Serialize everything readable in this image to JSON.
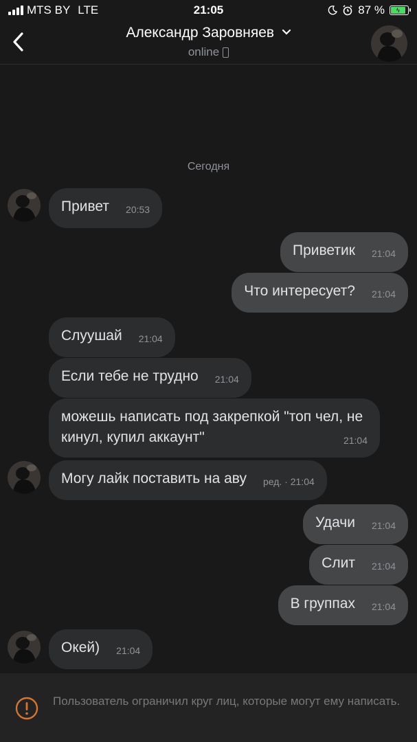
{
  "status_bar": {
    "carrier": "MTS BY",
    "network": "LTE",
    "time": "21:05",
    "battery": "87 %"
  },
  "header": {
    "name": "Александр Заровняев",
    "status": "online"
  },
  "chat": {
    "date_separator": "Сегодня",
    "messages": [
      {
        "text": "Привет",
        "time": "20:53",
        "direction": "in"
      },
      {
        "text": "Приветик",
        "time": "21:04",
        "direction": "out"
      },
      {
        "text": "Что интересует?",
        "time": "21:04",
        "direction": "out"
      },
      {
        "text": "Слуушай",
        "time": "21:04",
        "direction": "in"
      },
      {
        "text": "Если тебе не трудно",
        "time": "21:04",
        "direction": "in"
      },
      {
        "text": "можешь написать под закрепкой \"топ чел, не кинул, купил аккаунт\"",
        "time": "21:04",
        "direction": "in"
      },
      {
        "text": "Могу лайк поставить на аву",
        "time": "ред. · 21:04",
        "direction": "in"
      },
      {
        "text": "Удачи",
        "time": "21:04",
        "direction": "out"
      },
      {
        "text": "Слит",
        "time": "21:04",
        "direction": "out"
      },
      {
        "text": "В группах",
        "time": "21:04",
        "direction": "out"
      },
      {
        "text": "Окей)",
        "time": "21:04",
        "direction": "in"
      }
    ]
  },
  "footer": {
    "notice": "Пользователь ограничил круг лиц, которые могут ему написать."
  },
  "colors": {
    "background": "#19191a",
    "incoming_bubble": "#2c2d2e",
    "outgoing_bubble": "#454647",
    "battery_green": "#4cd964",
    "warning_orange": "#d7752c"
  },
  "icons": [
    "signal-icon",
    "moon-icon",
    "alarm-icon",
    "battery-icon",
    "back-arrow-icon",
    "chevron-down-icon",
    "phone-icon",
    "warning-icon"
  ]
}
